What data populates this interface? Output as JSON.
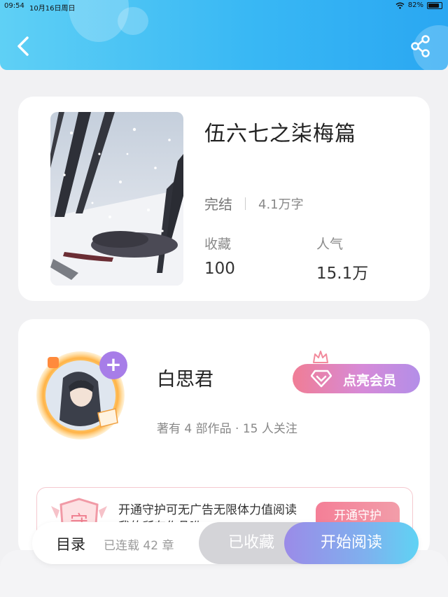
{
  "status_bar": {
    "time": "09:54",
    "date": "10月16日周日",
    "battery": "82%",
    "battery_level": 0.82
  },
  "header": {
    "back_icon": "chevron-left-icon",
    "share_icon": "share-icon"
  },
  "book": {
    "title": "伍六七之柒梅篇",
    "status": "完结",
    "word_count": "4.1万字",
    "stats": [
      {
        "label": "收藏",
        "value": "100"
      },
      {
        "label": "人气",
        "value": "15.1万"
      }
    ]
  },
  "author": {
    "name": "白思君",
    "meta": "著有 4 部作品 · 15 人关注",
    "follow_icon": "plus-icon",
    "vip_button": "点亮会员"
  },
  "guard": {
    "text": "开通守护可无广告无限体力值阅读我的所有作品哟",
    "badge": "守",
    "button": "开通守护"
  },
  "actions": {
    "toc": "目录",
    "serial": "已连载 42 章",
    "collected": "已收藏",
    "read": "开始阅读"
  },
  "colors": {
    "header_accent": "#39b8f4",
    "vip_gradient_start": "#f07d95",
    "read_gradient_end": "#5fd3f4"
  }
}
